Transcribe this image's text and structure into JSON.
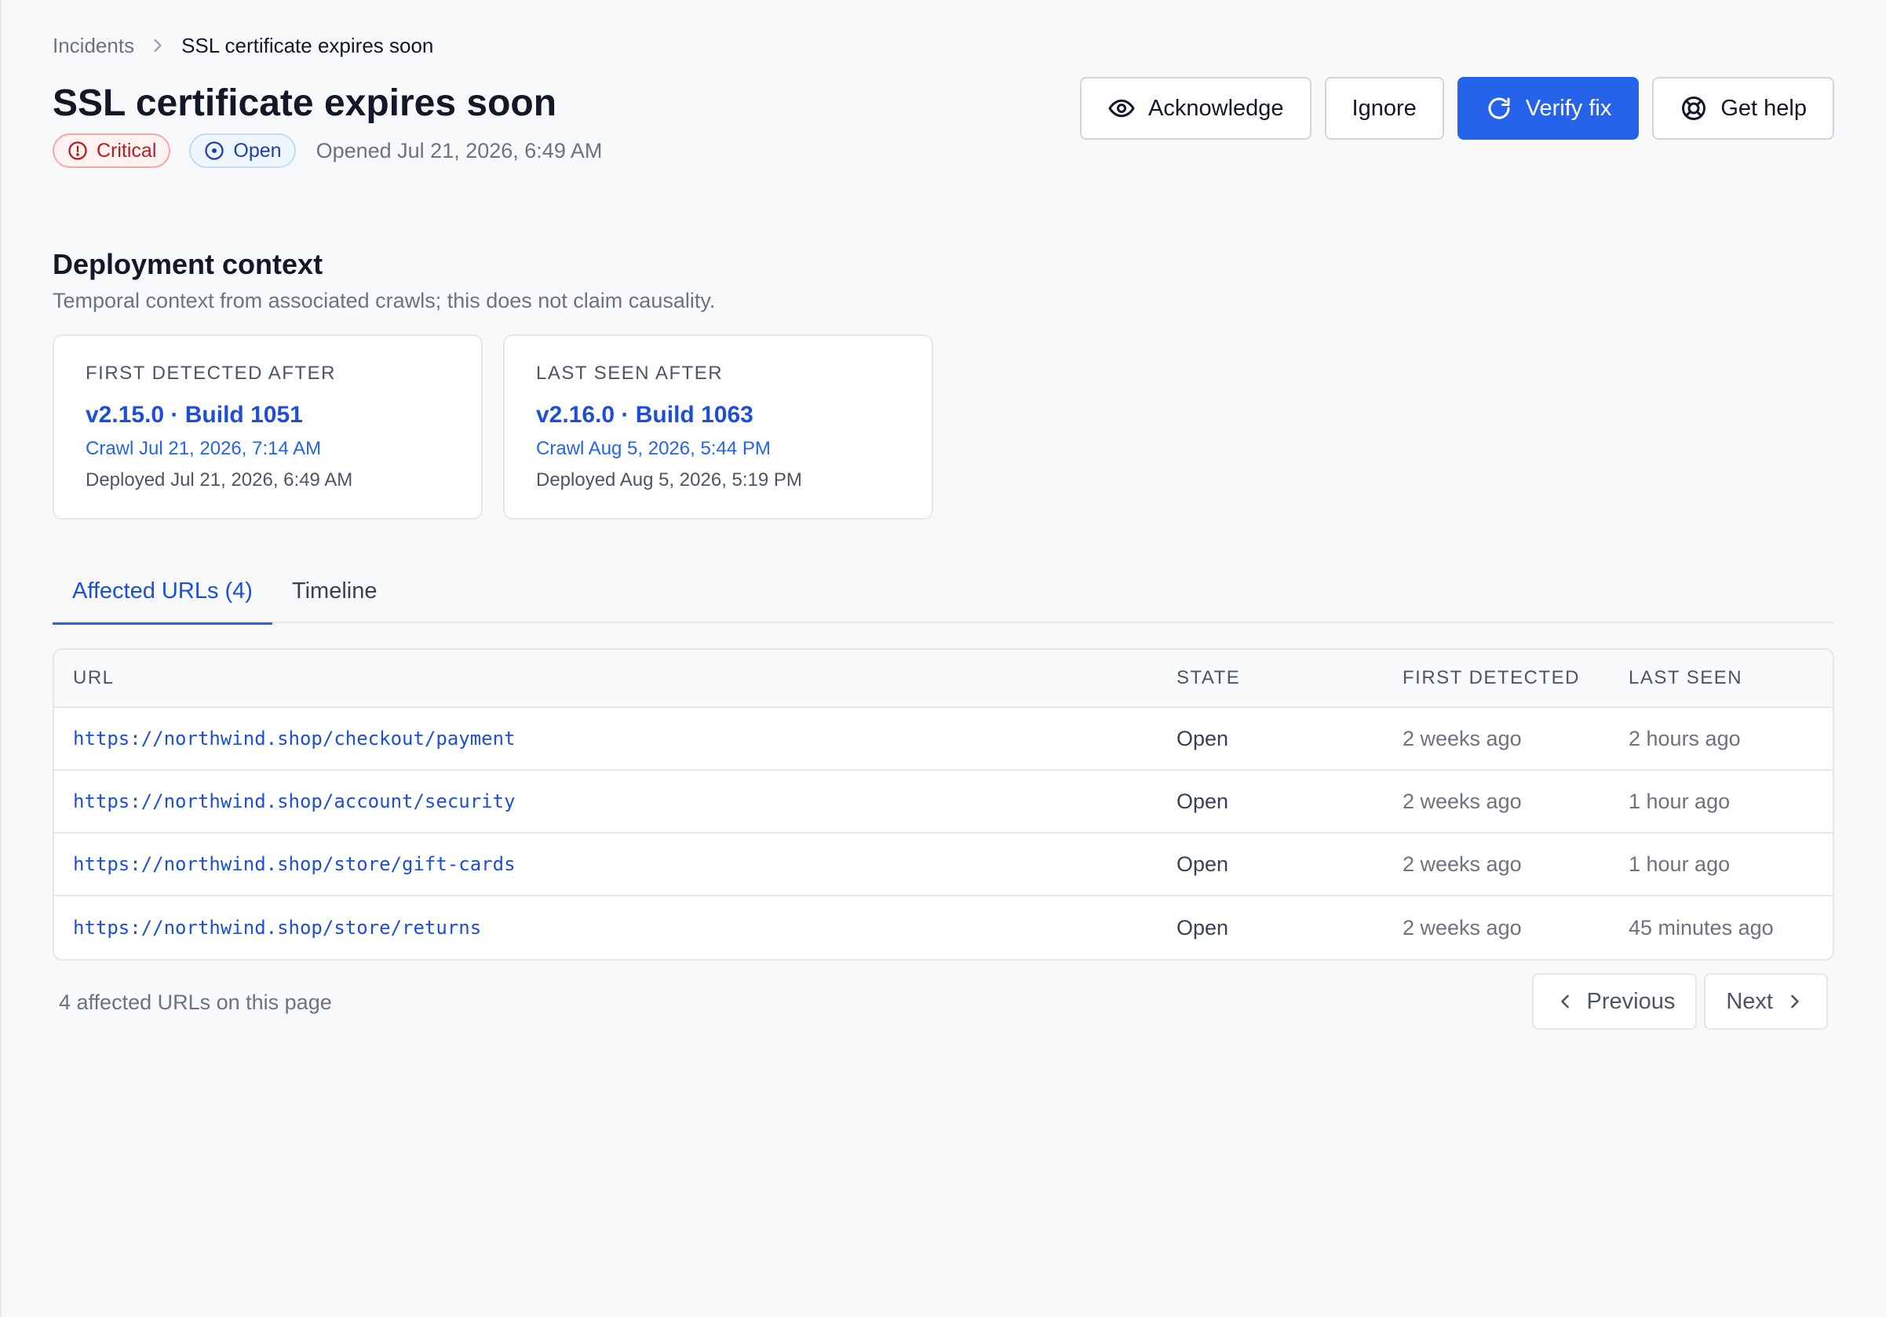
{
  "breadcrumb": {
    "parent": "Incidents",
    "current": "SSL certificate expires soon"
  },
  "incident": {
    "title": "SSL certificate expires soon",
    "severity": "Critical",
    "status": "Open",
    "opened": "Opened Jul 21, 2026, 6:49 AM"
  },
  "actions": {
    "acknowledge": "Acknowledge",
    "ignore": "Ignore",
    "verify": "Verify fix",
    "help": "Get help"
  },
  "deployment": {
    "title": "Deployment context",
    "subtitle": "Temporal context from associated crawls; this does not claim causality.",
    "first": {
      "label": "FIRST DETECTED AFTER",
      "version": "v2.15.0 · Build 1051",
      "crawl": "Crawl Jul 21, 2026, 7:14 AM",
      "deployed": "Deployed Jul 21, 2026, 6:49 AM"
    },
    "last": {
      "label": "LAST SEEN AFTER",
      "version": "v2.16.0 · Build 1063",
      "crawl": "Crawl Aug 5, 2026, 5:44 PM",
      "deployed": "Deployed Aug 5, 2026, 5:19 PM"
    }
  },
  "tabs": [
    {
      "label": "Affected URLs (4)",
      "active": true
    },
    {
      "label": "Timeline",
      "active": false
    }
  ],
  "table": {
    "headers": {
      "url": "URL",
      "state": "STATE",
      "first": "FIRST DETECTED",
      "last": "LAST SEEN"
    },
    "rows": [
      {
        "url": "https://northwind.shop/checkout/payment",
        "state": "Open",
        "first": "2 weeks ago",
        "last": "2 hours ago"
      },
      {
        "url": "https://northwind.shop/account/security",
        "state": "Open",
        "first": "2 weeks ago",
        "last": "1 hour ago"
      },
      {
        "url": "https://northwind.shop/store/gift-cards",
        "state": "Open",
        "first": "2 weeks ago",
        "last": "1 hour ago"
      },
      {
        "url": "https://northwind.shop/store/returns",
        "state": "Open",
        "first": "2 weeks ago",
        "last": "45 minutes ago"
      }
    ]
  },
  "footer": {
    "count": "4 affected URLs on this page",
    "previous": "Previous",
    "next": "Next"
  },
  "colors": {
    "primary": "#2563eb",
    "link": "#1d4ed8",
    "critical": "#b91c1c",
    "background": "#f8f9fb"
  },
  "icons": {
    "breadcrumb_separator": "chevron-right-icon",
    "severity": "alert-circle-icon",
    "status": "dot-circle-icon",
    "acknowledge": "eye-icon",
    "verify": "refresh-icon",
    "help": "life-buoy-icon",
    "previous": "chevron-left-icon",
    "next": "chevron-right-icon"
  }
}
